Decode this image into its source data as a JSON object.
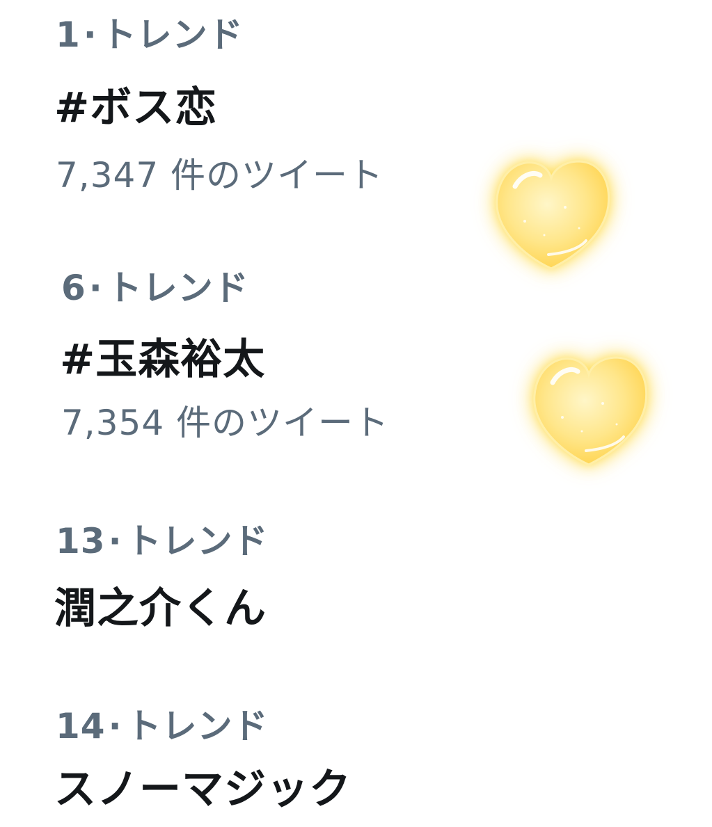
{
  "trends": [
    {
      "rank": "1",
      "separator": "·",
      "meta_label": "トレンド",
      "title": "#ボス恋",
      "count": "7,347 件のツイート"
    },
    {
      "rank": "6",
      "separator": "·",
      "meta_label": "トレンド",
      "title": "#玉森裕太",
      "count": "7,354 件のツイート"
    },
    {
      "rank": "13",
      "separator": "·",
      "meta_label": "トレンド",
      "title": "潤之介くん"
    },
    {
      "rank": "14",
      "separator": "·",
      "meta_label": "トレンド",
      "title": "スノーマジック"
    }
  ],
  "stickers": {
    "heart_icon": "yellow-heart-icon",
    "heart_color": "#FFD95A"
  },
  "colors": {
    "meta_text": "#5B6B7A",
    "title_text": "#14171A",
    "background": "#FFFFFF"
  }
}
